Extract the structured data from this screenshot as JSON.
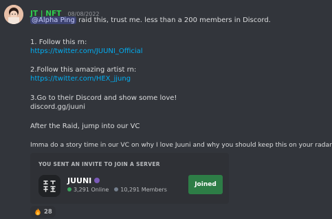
{
  "message": {
    "username": "JT | NFT",
    "timestamp": "08/08/2022",
    "mention": "@Alpha Ping",
    "line1_rest": " raid this, trust me. less than a 200 members in Discord.",
    "step1": "1. Follow this rn:",
    "link1": "https://twitter.com/JUUNI_Official",
    "step2": "2.Follow this amazing artist rn:",
    "link2": "https://twitter.com/HEX_jjung",
    "step3": "3.Go to their Discord and show some love!",
    "discord_link": "discord.gg/juuni",
    "after_raid": "After the Raid, jump into our VC",
    "story_line": "Imma do a story time in our VC on why I love Juuni and why you should keep this on your radar"
  },
  "invite": {
    "title": "YOU SENT AN INVITE TO JOIN A SERVER",
    "server_name": "JUUNI",
    "online": "3,291 Online",
    "members": "10,291 Members",
    "button_label": "Joined"
  },
  "reaction": {
    "emoji": "fire-icon",
    "count": "28"
  },
  "colors": {
    "username": "#2fce4f",
    "link": "#00aff4",
    "join_button": "#2d7d46",
    "online_dot": "#3ba55d"
  }
}
